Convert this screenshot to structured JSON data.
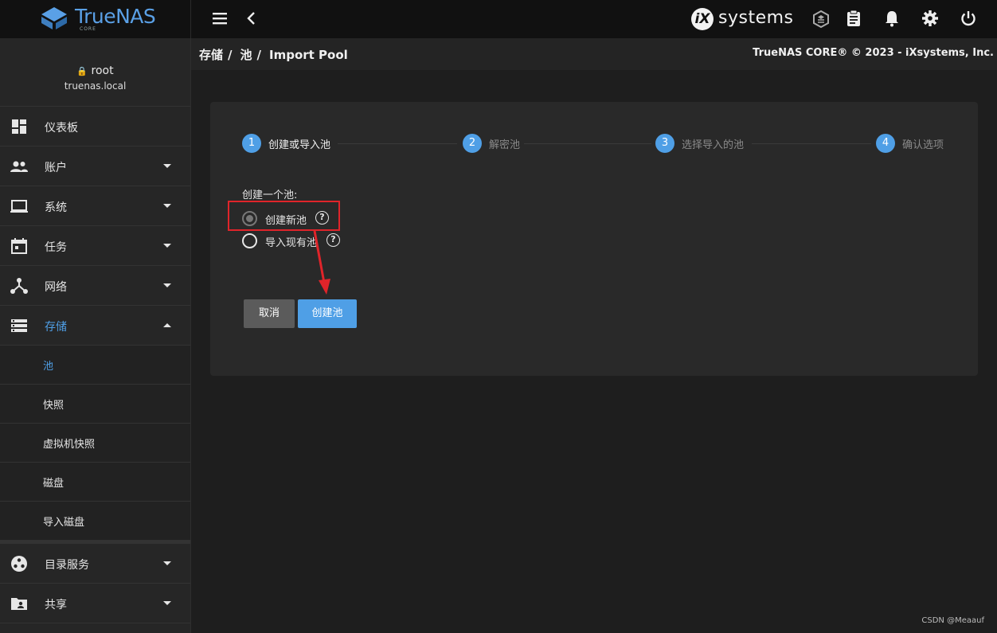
{
  "app": {
    "logo_text": "TrueNAS",
    "logo_sub": "CORE",
    "vendor_logo_letter": "iX",
    "vendor_logo_text": "systems"
  },
  "user": {
    "name": "root",
    "host": "truenas.local"
  },
  "sidebar": {
    "items": [
      {
        "label": "仪表板",
        "icon": "dashboard-icon"
      },
      {
        "label": "账户",
        "icon": "accounts-icon"
      },
      {
        "label": "系统",
        "icon": "system-icon"
      },
      {
        "label": "任务",
        "icon": "calendar-icon"
      },
      {
        "label": "网络",
        "icon": "network-icon"
      },
      {
        "label": "存储",
        "icon": "storage-icon"
      }
    ],
    "storage_sub": [
      {
        "label": "池"
      },
      {
        "label": "快照"
      },
      {
        "label": "虚拟机快照"
      },
      {
        "label": "磁盘"
      },
      {
        "label": "导入磁盘"
      }
    ],
    "bottom_items": [
      {
        "label": "目录服务",
        "icon": "directory-icon"
      },
      {
        "label": "共享",
        "icon": "shares-icon"
      }
    ]
  },
  "breadcrumb": {
    "parts": [
      "存储",
      "池",
      "Import Pool"
    ]
  },
  "copyright": "TrueNAS CORE® © 2023 - iXsystems, Inc.",
  "wizard": {
    "steps": [
      {
        "num": "1",
        "label": "创建或导入池"
      },
      {
        "num": "2",
        "label": "解密池"
      },
      {
        "num": "3",
        "label": "选择导入的池"
      },
      {
        "num": "4",
        "label": "确认选项"
      }
    ],
    "active_step": 1,
    "form_title": "创建一个池:",
    "options": [
      {
        "label": "创建新池",
        "selected": true
      },
      {
        "label": "导入现有池",
        "selected": false
      }
    ],
    "help_glyph": "?",
    "cancel_label": "取消",
    "create_label": "创建池"
  },
  "colors": {
    "accent": "#4f9fe6",
    "annotation": "#e0242a"
  },
  "watermark": "CSDN @Meaauf"
}
